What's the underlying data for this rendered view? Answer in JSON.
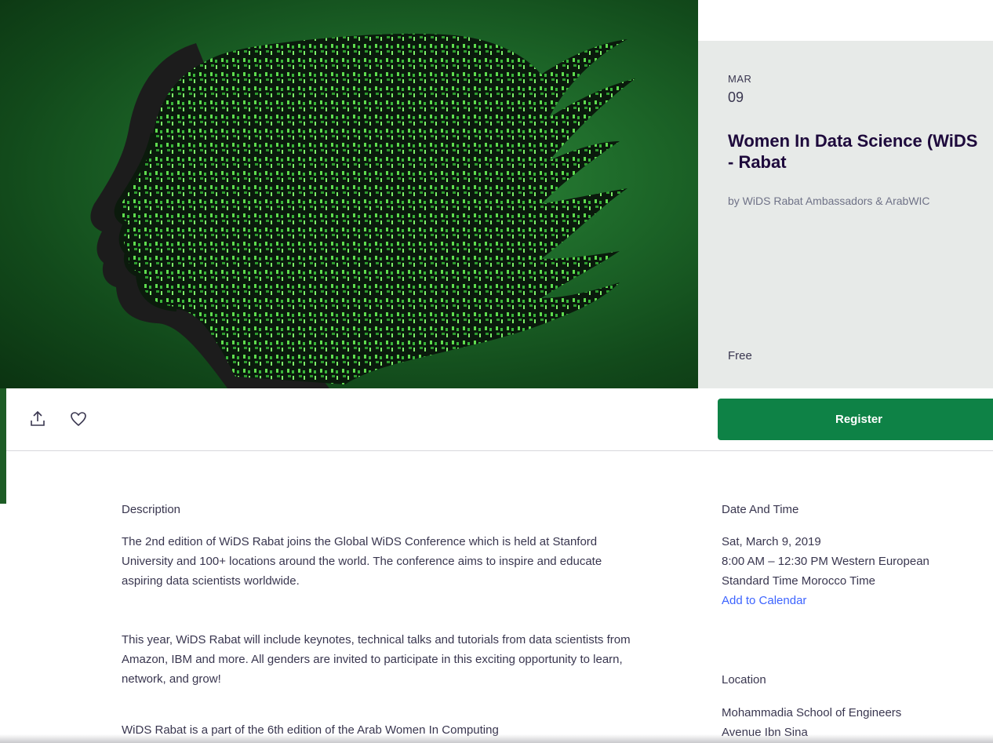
{
  "event": {
    "month": "MAR",
    "day": "09",
    "title_line1": "Women In Data Science (WiDS",
    "title_line2": "- Rabat",
    "organizer": "by WiDS Rabat Ambassadors & ArabWIC",
    "price": "Free"
  },
  "actions": {
    "share_icon": "share-icon",
    "like_icon": "heart-icon",
    "register_label": "Register"
  },
  "description": {
    "heading": "Description",
    "paragraphs": [
      "The 2nd edition of WiDS Rabat joins the Global WiDS Conference which is held at Stanford University and 100+ locations around the world. The conference aims to inspire and educate aspiring data scientists worldwide.",
      "This year, WiDS Rabat will include keynotes, technical talks and tutorials from data scientists from Amazon, IBM and more. All genders are invited to participate in this exciting opportunity to learn, network, and grow!",
      "WiDS Rabat is a part of the 6th edition of the Arab Women In Computing"
    ]
  },
  "date_time": {
    "heading": "Date And Time",
    "date": "Sat, March 9, 2019",
    "time_line1": "8:00 AM – 12:30 PM Western European",
    "time_line2": "Standard Time Morocco Time",
    "calendar_link": "Add to Calendar"
  },
  "location": {
    "heading": "Location",
    "line1": "Mohammadia School of Engineers",
    "line2": "Avenue Ibn Sina"
  },
  "colors": {
    "accent": "#0e8246",
    "link": "#3d64ff",
    "hero_bg": "#1e6a2a",
    "card_bg": "#e7eae8"
  }
}
